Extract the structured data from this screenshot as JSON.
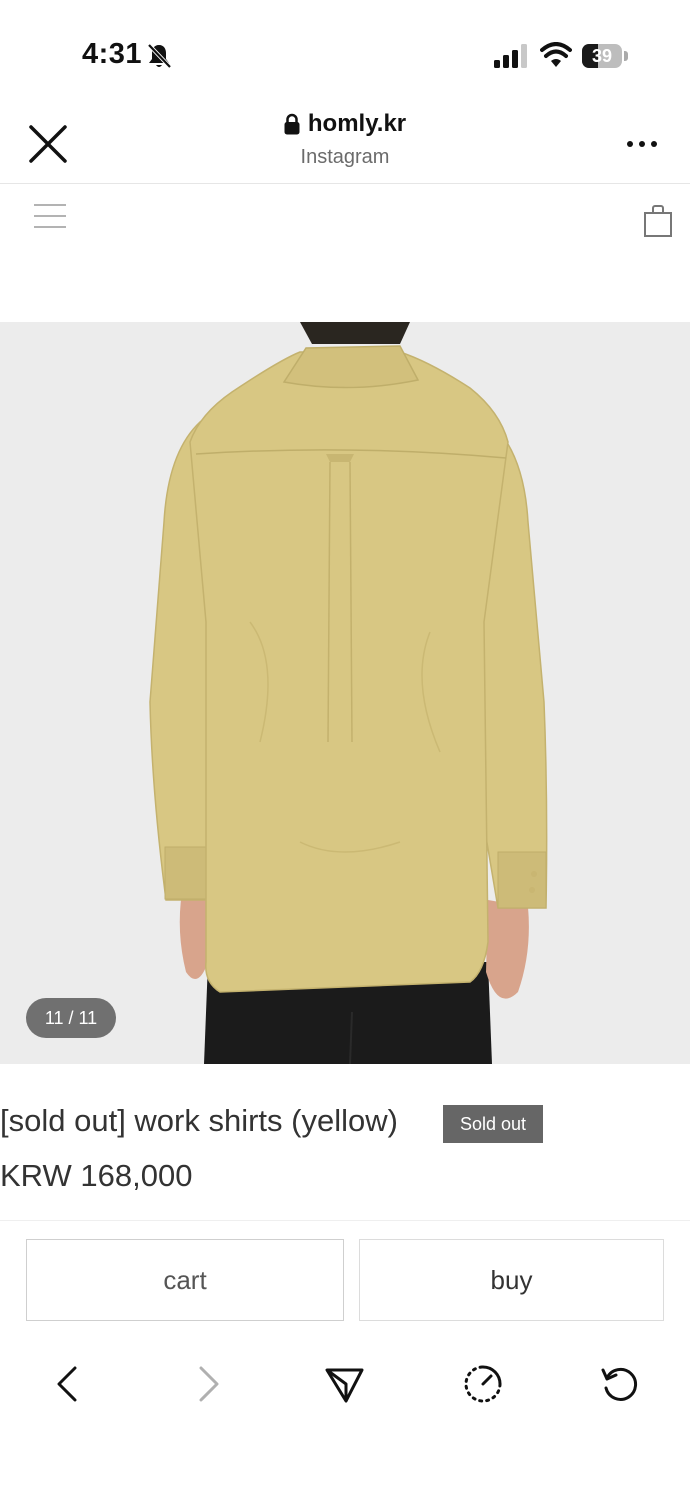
{
  "status_bar": {
    "time": "4:31",
    "battery_percent": 39,
    "battery_label": "39",
    "icons": [
      "bell-slash-icon",
      "cellular-signal-icon",
      "wifi-icon",
      "battery-icon"
    ]
  },
  "browser_header": {
    "domain": "homly.kr",
    "source": "Instagram",
    "icons": [
      "close-icon",
      "lock-icon",
      "more-icon"
    ]
  },
  "site_bar": {
    "icons": [
      "menu-icon",
      "shopping-bag-icon"
    ]
  },
  "product": {
    "image_counter": "11 / 11",
    "title": "[sold out] work shirts (yellow)",
    "badge": "Sold out",
    "price": "KRW 168,000",
    "shirt_color": "#d8c783"
  },
  "actions": {
    "cart_label": "cart",
    "buy_label": "buy"
  },
  "toolbar": {
    "icons": [
      "back-icon",
      "forward-icon",
      "share-icon",
      "history-icon",
      "reload-icon"
    ]
  }
}
